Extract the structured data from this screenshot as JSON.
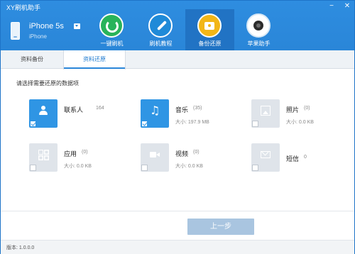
{
  "app": {
    "title": "XY刷机助手"
  },
  "device": {
    "name": "iPhone 5s",
    "model": "iPhone"
  },
  "nav": [
    {
      "label": "一键刷机",
      "icon": "refresh-icon"
    },
    {
      "label": "刷机教程",
      "icon": "wrench-icon"
    },
    {
      "label": "备份还原",
      "icon": "backup-icon"
    },
    {
      "label": "苹果助手",
      "icon": "camera-icon"
    }
  ],
  "tabs": [
    {
      "label": "资料备份"
    },
    {
      "label": "资料还原"
    }
  ],
  "main": {
    "prompt": "请选择需要还原的数据项",
    "items": [
      {
        "name": "联系人",
        "count": "164",
        "size": "",
        "icon": "contact-icon",
        "checked": true,
        "enabled": true
      },
      {
        "name": "音乐",
        "count": "(35)",
        "size": "大小: 197.9 MB",
        "icon": "music-icon",
        "checked": true,
        "enabled": true
      },
      {
        "name": "照片",
        "count": "(0)",
        "size": "大小: 0.0 KB",
        "icon": "photo-icon",
        "checked": false,
        "enabled": false
      },
      {
        "name": "应用",
        "count": "(0)",
        "size": "大小: 0.0 KB",
        "icon": "apps-icon",
        "checked": false,
        "enabled": false
      },
      {
        "name": "视频",
        "count": "(0)",
        "size": "大小: 0.0 KB",
        "icon": "video-icon",
        "checked": false,
        "enabled": false
      },
      {
        "name": "短信",
        "count": "0",
        "size": "",
        "icon": "sms-icon",
        "checked": false,
        "enabled": false
      }
    ],
    "prev_label": "上一步"
  },
  "status": {
    "version": "版本: 1.0.0.0"
  },
  "colors": {
    "header": "#2a86d8",
    "accent": "#2f95e4",
    "disabled_button": "#a9c5e0"
  }
}
